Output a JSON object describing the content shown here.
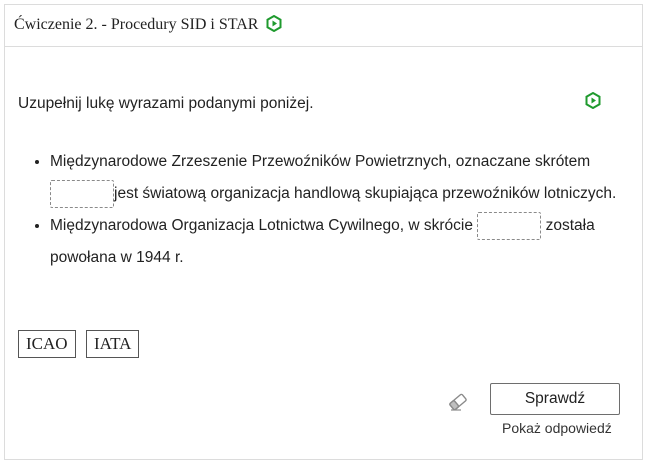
{
  "exercise": {
    "title": "Ćwiczenie 2. - Procedury SID i STAR",
    "instruction": "Uzupełnij lukę wyrazami podanymi poniżej."
  },
  "items": [
    {
      "before": "Międzynarodowe Zrzeszenie Przewoźników Powietrznych, oznaczane skrótem",
      "after": "jest światową organizacja handlową skupiająca przewoźników lotniczych."
    },
    {
      "before": "Międzynarodowa Organizacja Lotnictwa Cywilnego, w skrócie",
      "after": "została powołana w 1944 r."
    }
  ],
  "options": [
    "ICAO",
    "IATA"
  ],
  "actions": {
    "check_label": "Sprawdź",
    "show_answer_label": "Pokaż odpowiedź"
  },
  "icons": {
    "accent_color": "#1f9a2e",
    "exercise_icon": "hexagon-play-icon",
    "reset_icon": "eraser-icon"
  }
}
